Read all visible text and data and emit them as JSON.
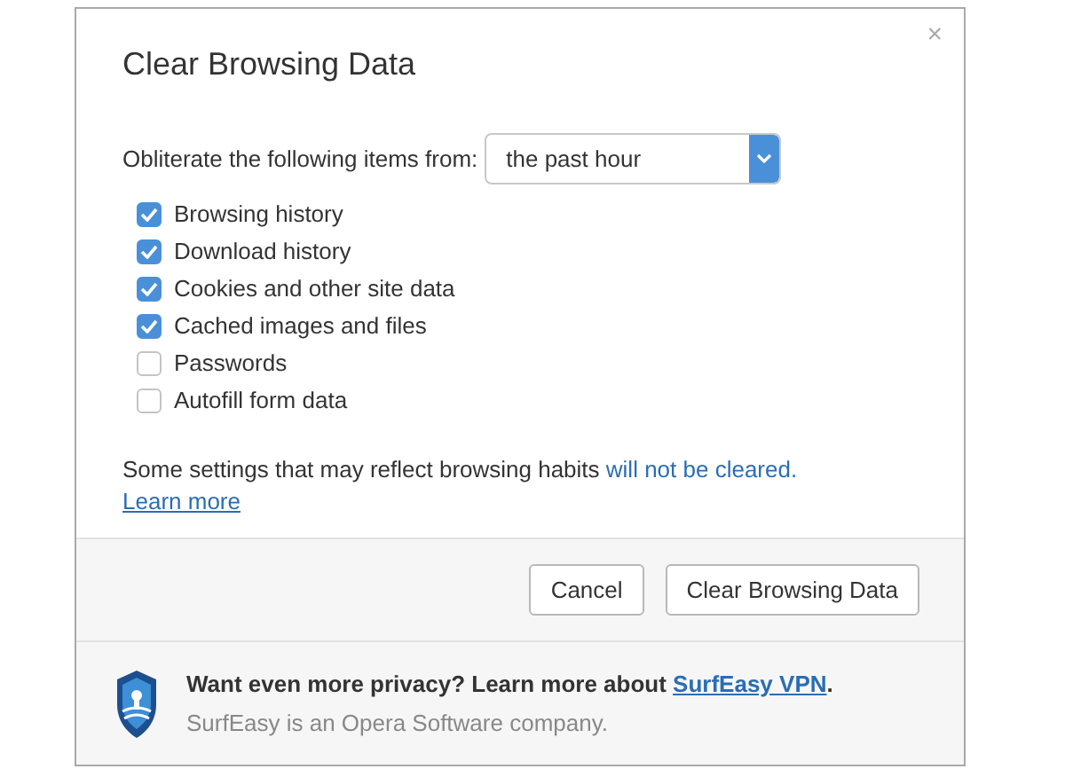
{
  "dialog": {
    "title": "Clear Browsing Data",
    "close": "×"
  },
  "range": {
    "label": "Obliterate the following items from:",
    "value": "the past hour"
  },
  "items": [
    {
      "label": "Browsing history",
      "checked": true
    },
    {
      "label": "Download history",
      "checked": true
    },
    {
      "label": "Cookies and other site data",
      "checked": true
    },
    {
      "label": "Cached images and files",
      "checked": true
    },
    {
      "label": "Passwords",
      "checked": false
    },
    {
      "label": "Autofill form data",
      "checked": false
    }
  ],
  "note": {
    "text": "Some settings that may reflect browsing habits ",
    "highlight": "will not be cleared.",
    "link": "Learn more"
  },
  "buttons": [
    {
      "label": "Cancel"
    },
    {
      "label": "Clear Browsing Data"
    }
  ],
  "promo": {
    "text": "Want even more privacy? Learn more about ",
    "link": "SurfEasy VPN",
    "end": ".",
    "subtext": "SurfEasy is an Opera Software company."
  }
}
